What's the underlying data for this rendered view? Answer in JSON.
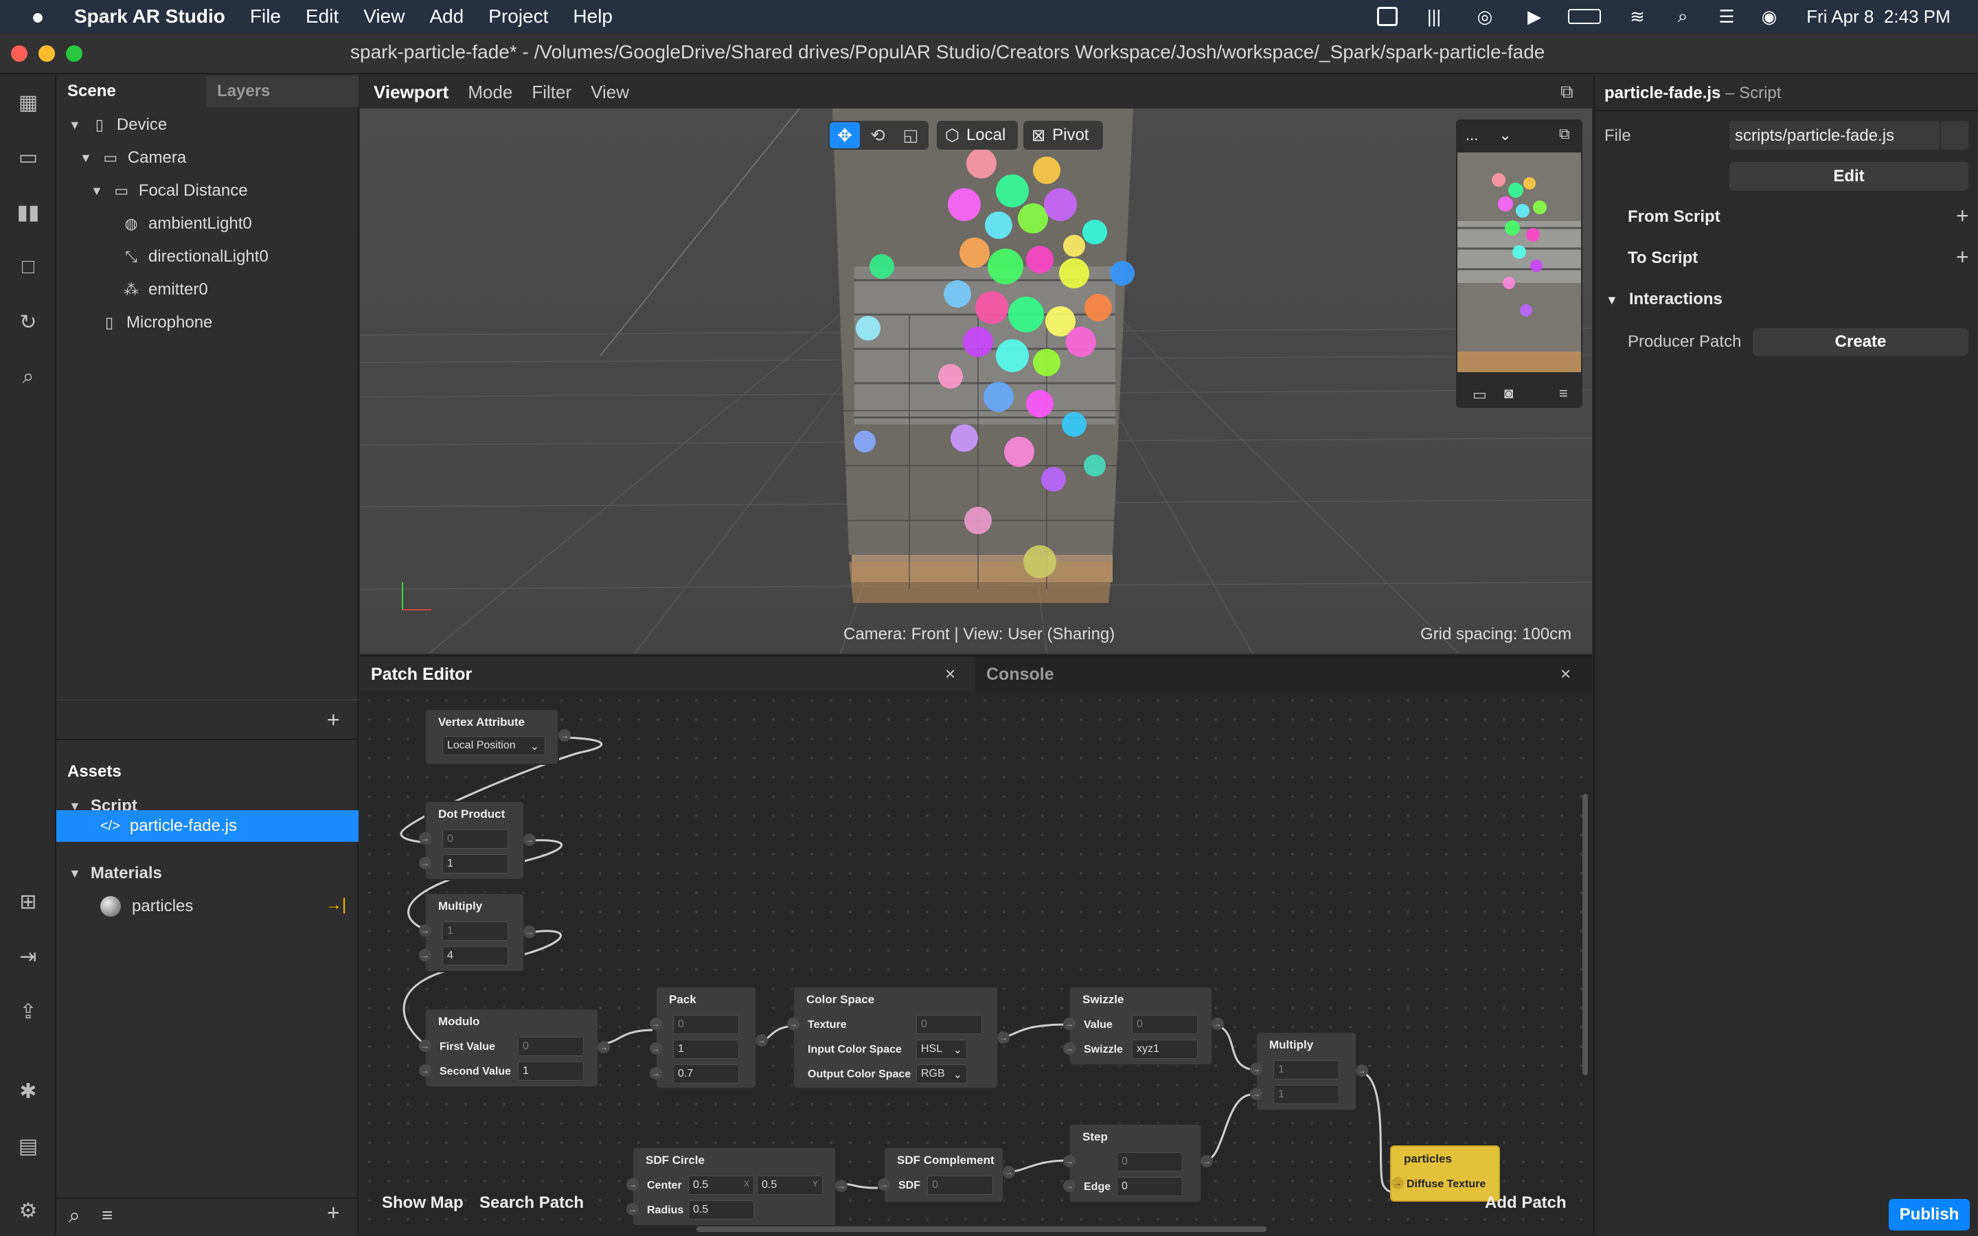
{
  "menubar": {
    "app_name": "Spark AR Studio",
    "items": [
      "File",
      "Edit",
      "View",
      "Add",
      "Project",
      "Help"
    ],
    "clock": "Fri Apr 8  2:43 PM"
  },
  "window": {
    "title": "spark-particle-fade* - /Volumes/GoogleDrive/Shared drives/PopulAR Studio/Creators Workspace/Josh/workspace/_Spark/spark-particle-fade"
  },
  "scene_panel": {
    "tab_scene": "Scene",
    "tab_layers": "Layers",
    "tree": [
      {
        "label": "Device",
        "icon": "phone-icon"
      },
      {
        "label": "Camera",
        "icon": "camera-icon"
      },
      {
        "label": "Focal Distance",
        "icon": "ruler-icon"
      },
      {
        "label": "ambientLight0",
        "icon": "globe-icon"
      },
      {
        "label": "directionalLight0",
        "icon": "light-icon"
      },
      {
        "label": "emitter0",
        "icon": "emitter-icon"
      },
      {
        "label": "Microphone",
        "icon": "microphone-icon"
      }
    ]
  },
  "assets": {
    "title": "Assets",
    "script_group": "Script",
    "script_file": "particle-fade.js",
    "materials_group": "Materials",
    "material": "particles"
  },
  "viewport": {
    "tabs": [
      "Viewport",
      "Mode",
      "Filter",
      "View"
    ],
    "local_label": "Local",
    "pivot_label": "Pivot",
    "camera_status": "Camera: Front | View: User (Sharing)",
    "grid_spacing": "Grid spacing: 100cm",
    "preview_dropdown": "..."
  },
  "inspector": {
    "file_name": "particle-fade.js",
    "file_type": "– Script",
    "file_label": "File",
    "file_value": "scripts/particle-fade.js",
    "edit_button": "Edit",
    "from_script": "From Script",
    "to_script": "To Script",
    "interactions": "Interactions",
    "producer_patch": "Producer Patch",
    "create_button": "Create"
  },
  "patch_editor": {
    "tab_patch": "Patch Editor",
    "tab_console": "Console",
    "show_map": "Show Map",
    "search_patch": "Search Patch",
    "add_patch": "Add Patch",
    "nodes": {
      "vertex_attribute": {
        "title": "Vertex Attribute",
        "dropdown": "Local Position"
      },
      "dot_product": {
        "title": "Dot Product",
        "in1": "0",
        "in2": "1"
      },
      "multiply1": {
        "title": "Multiply",
        "in1": "1",
        "in2": "4"
      },
      "modulo": {
        "title": "Modulo",
        "first_label": "First Value",
        "first": "0",
        "second_label": "Second Value",
        "second": "1"
      },
      "pack": {
        "title": "Pack",
        "in1": "0",
        "in2": "1",
        "in3": "0.7"
      },
      "color_space": {
        "title": "Color Space",
        "texture_label": "Texture",
        "texture": "0",
        "input_label": "Input Color Space",
        "input": "HSL",
        "output_label": "Output Color Space",
        "output": "RGB"
      },
      "swizzle": {
        "title": "Swizzle",
        "value_label": "Value",
        "value": "0",
        "swizzle_label": "Swizzle",
        "swizzle": "xyz1"
      },
      "multiply2": {
        "title": "Multiply",
        "in1": "1",
        "in2": "1"
      },
      "sdf_circle": {
        "title": "SDF Circle",
        "center_label": "Center",
        "cx": "0.5",
        "cy": "0.5",
        "x_tag": "X",
        "y_tag": "Y",
        "radius_label": "Radius",
        "radius": "0.5"
      },
      "sdf_complement": {
        "title": "SDF Complement",
        "sdf_label": "SDF",
        "sdf": "0"
      },
      "step": {
        "title": "Step",
        "in1": "0",
        "edge_label": "Edge",
        "edge": "0"
      },
      "particles": {
        "title": "particles",
        "port": "Diffuse Texture"
      }
    }
  },
  "publish_button": "Publish",
  "colors": {
    "accent": "#0a84ff",
    "menubar": "#26303f",
    "particles_node": "#e2c23a"
  }
}
